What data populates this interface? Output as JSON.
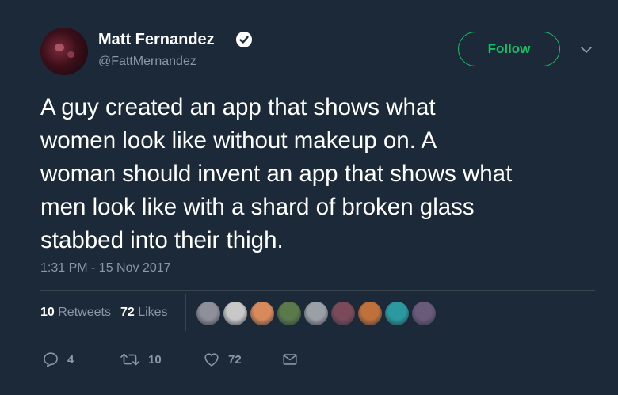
{
  "author": {
    "name": "Matt Fernandez",
    "handle": "@FattMernandez",
    "verified": true
  },
  "follow_button": {
    "label": "Follow"
  },
  "tweet": {
    "lines": [
      "A guy created an app that shows what",
      "women look like without makeup on. A",
      "woman should invent an app that shows what",
      "men look like with a shard of broken glass",
      "stabbed into their thigh."
    ],
    "timestamp": "1:31 PM - 15 Nov 2017"
  },
  "stats": {
    "retweets_count": "10",
    "retweets_label": "Retweets",
    "likes_count": "72",
    "likes_label": "Likes"
  },
  "likers": [
    {
      "color": "#8f8f9a"
    },
    {
      "color": "#c8c8c8"
    },
    {
      "color": "#d88a5a"
    },
    {
      "color": "#5a7a4a"
    },
    {
      "color": "#9aa0a6"
    },
    {
      "color": "#7a4a5a"
    },
    {
      "color": "#c0703a"
    },
    {
      "color": "#2a9aa0"
    },
    {
      "color": "#6a5a7a"
    }
  ],
  "actions": {
    "reply_count": "4",
    "retweet_count": "10",
    "like_count": "72"
  },
  "icons": {
    "verified": "verified-badge-icon",
    "chevron": "chevron-down-icon",
    "reply": "reply-icon",
    "retweet": "retweet-icon",
    "like": "heart-icon",
    "dm": "envelope-icon"
  },
  "colors": {
    "background": "#1c2938",
    "accent": "#17bf63",
    "muted": "#8899a6",
    "divider": "#38444d"
  }
}
